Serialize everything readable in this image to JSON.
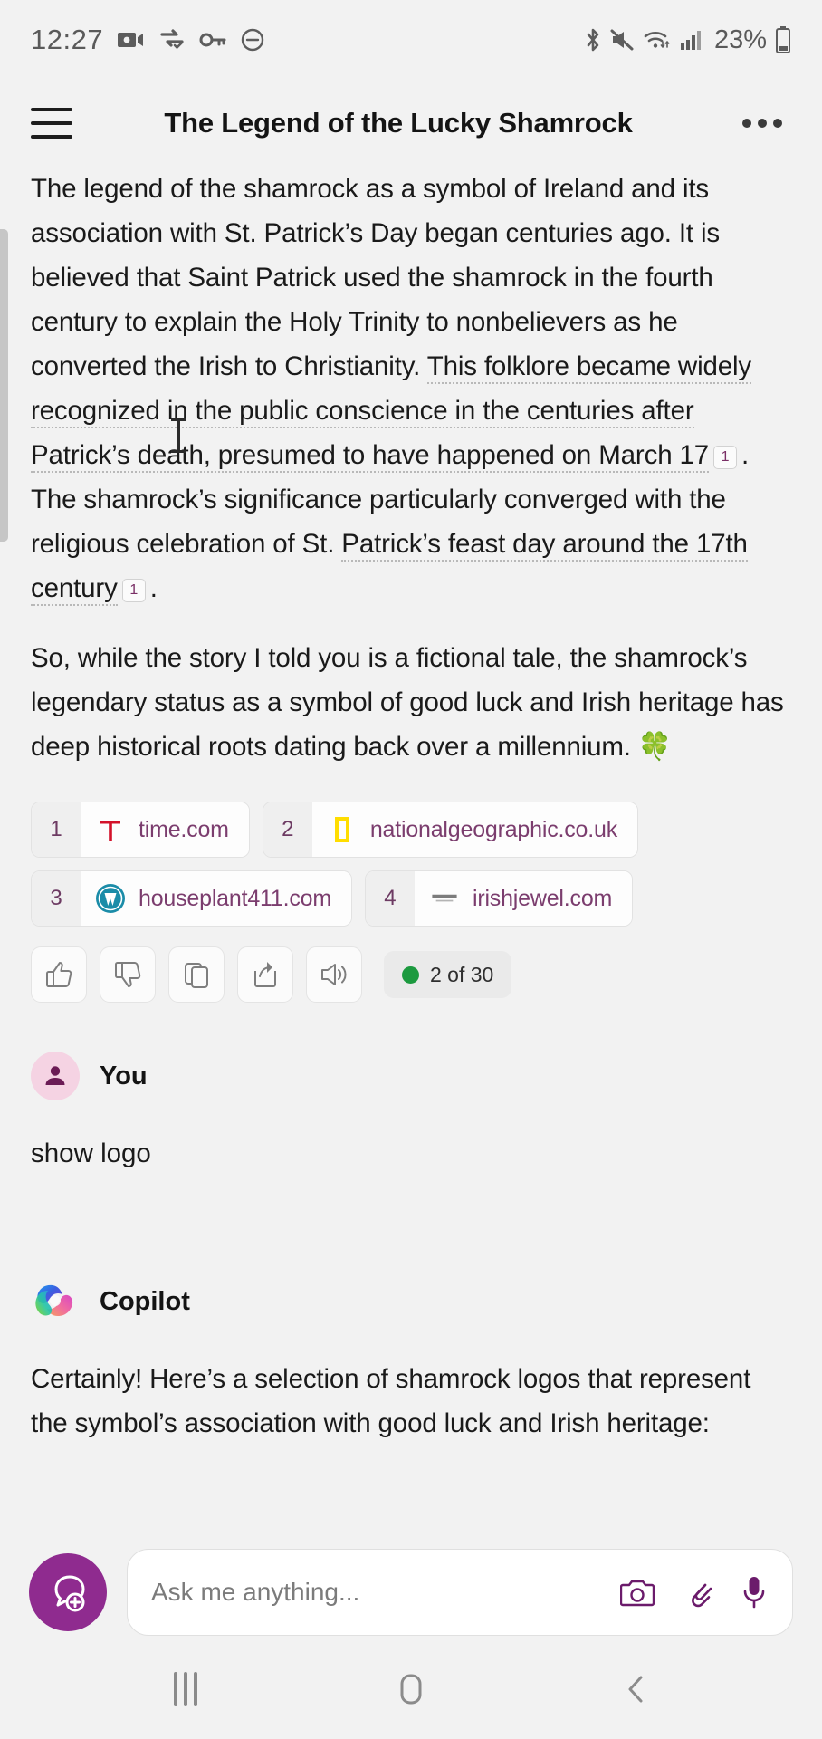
{
  "status_bar": {
    "time": "12:27",
    "battery_percent": "23%",
    "left_icons": [
      "video-camera-icon",
      "data-sync-icon",
      "vpn-key-icon",
      "do-not-disturb-icon"
    ],
    "right_icons": [
      "bluetooth-icon",
      "mute-icon",
      "wifi-icon",
      "cellular-signal-icon",
      "battery-icon"
    ]
  },
  "app_header": {
    "title": "The Legend of the Lucky Shamrock",
    "menu_icon": "hamburger-menu-icon",
    "overflow_icon": "more-options-icon"
  },
  "conversation": {
    "assistant_message": {
      "p1_a": "The legend of the shamrock as a symbol of Ireland and its association with St. Patrick’s Day began centuries ago. It is believed that Saint Patrick used the shamrock in the fourth century to explain the Holy Trinity to nonbelievers as he converted the Irish to Christianity. ",
      "p1_b": "This folklore became widely recognized in the public conscience in the centuries after Patrick’s death, presumed to have happened on March 17",
      "p1_chip1": "1",
      "p1_c": ". The shamrock’s significance particularly converged with the religious celebration of St. ",
      "p1_d": "Patrick’s feast day around the 17th century",
      "p1_chip2": "1",
      "p1_e": ".",
      "p2": "So, while the story I told you is a fictional tale, the shamrock’s legendary status as a symbol of good luck and Irish heritage has deep historical roots dating back over a millennium.",
      "p2_emoji": "🍀"
    },
    "citations": [
      {
        "number": "1",
        "host": "time.com",
        "favicon": "time-logo-icon"
      },
      {
        "number": "2",
        "host": "nationalgeographic.co.uk",
        "favicon": "natgeo-logo-icon"
      },
      {
        "number": "3",
        "host": "houseplant411.com",
        "favicon": "wordpress-logo-icon"
      },
      {
        "number": "4",
        "host": "irishjewel.com",
        "favicon": "irishjewel-logo-icon"
      }
    ],
    "actions": [
      {
        "name": "thumbs-up-button",
        "icon": "thumbs-up-icon"
      },
      {
        "name": "thumbs-down-button",
        "icon": "thumbs-down-icon"
      },
      {
        "name": "copy-button",
        "icon": "copy-icon"
      },
      {
        "name": "share-button",
        "icon": "share-icon"
      },
      {
        "name": "speak-aloud-button",
        "icon": "speaker-icon"
      }
    ],
    "counter": {
      "label": "2 of 30",
      "dot_color": "#1c9a3f"
    },
    "user_turn": {
      "name": "You",
      "avatar": "person-avatar-icon",
      "message": "show logo"
    },
    "copilot_turn": {
      "name": "Copilot",
      "avatar": "copilot-logo-icon",
      "message": "Certainly! Here’s a selection of shamrock logos that represent the symbol’s association with good luck and Irish heritage:"
    }
  },
  "composer": {
    "new_chat_icon": "new-chat-bubble-plus-icon",
    "placeholder": "Ask me anything...",
    "value": "",
    "icons": [
      {
        "name": "camera-button",
        "icon": "camera-icon"
      },
      {
        "name": "attach-button",
        "icon": "paperclip-icon"
      },
      {
        "name": "microphone-button",
        "icon": "microphone-icon"
      }
    ]
  },
  "nav_bar": {
    "recents": "recent-apps-icon",
    "home": "home-icon",
    "back": "back-icon"
  },
  "theme": {
    "bg": "#f2f2f2",
    "accent_purple": "#8f2b8f",
    "link_purple": "#7b3d6e",
    "green": "#1c9a3f"
  }
}
